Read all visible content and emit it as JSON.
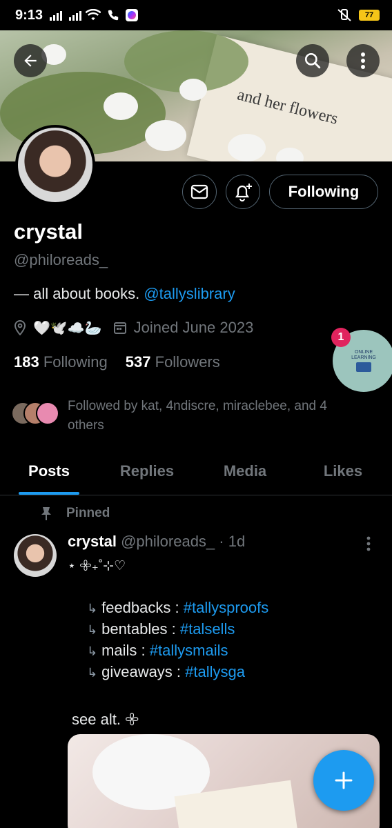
{
  "status_bar": {
    "time": "9:13",
    "battery": "77"
  },
  "profile": {
    "display_name": "crystal",
    "handle": "@philoreads_",
    "bio_text": "— all about books. ",
    "bio_link": "@tallyslibrary",
    "bio_emojis": "🤍🕊️☁️🦢",
    "joined": "Joined June 2023",
    "following_count": "183",
    "following_label": "Following",
    "followers_count": "537",
    "followers_label": "Followers",
    "follow_button": "Following",
    "followed_by": "Followed by kat, 4ndiscre, miraclebee, and 4 others"
  },
  "banner_text": "and her flowers",
  "floating_badge": {
    "count": "1",
    "line1": "ONLINE",
    "line2": "LEARNING"
  },
  "tabs": [
    {
      "label": "Posts"
    },
    {
      "label": "Replies"
    },
    {
      "label": "Media"
    },
    {
      "label": "Likes"
    }
  ],
  "post": {
    "pinned_label": "Pinned",
    "author": "crystal",
    "handle": "@philoreads_",
    "time": "· 1d",
    "line1": "⋆ 𖧷₊˚⊹♡",
    "items": [
      {
        "arrow": "↳",
        "label": "feedbacks : ",
        "tag": "#tallysproofs"
      },
      {
        "arrow": "↳",
        "label": "bentables : ",
        "tag": "#talsells"
      },
      {
        "arrow": "↳",
        "label": "mails : ",
        "tag": "#tallysmails"
      },
      {
        "arrow": "↳",
        "label": "giveaways : ",
        "tag": "#tallysga"
      }
    ],
    "footer": "see alt. 𖧷"
  },
  "colors": {
    "accent": "#1d9bf0",
    "muted": "#71767b",
    "background": "#000000"
  }
}
